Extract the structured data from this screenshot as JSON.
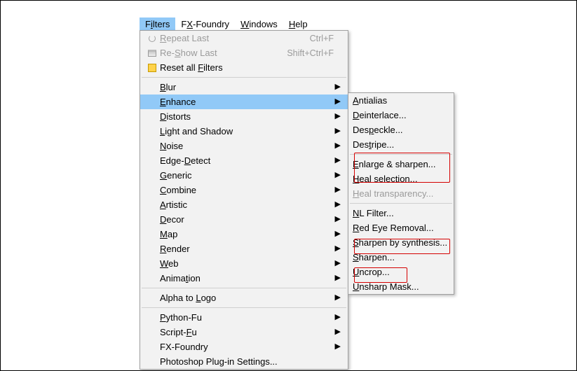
{
  "menubar": [
    {
      "label": "Filters",
      "mnemonic": "i",
      "active": true
    },
    {
      "label": "FX-Foundry",
      "mnemonic": "X"
    },
    {
      "label": "Windows",
      "mnemonic": "W"
    },
    {
      "label": "Help",
      "mnemonic": "H"
    }
  ],
  "primary_menu": [
    {
      "kind": "item",
      "label": "Repeat Last",
      "mnemonic_index": 0,
      "shortcut": "Ctrl+F",
      "icon": "repeat",
      "disabled": true
    },
    {
      "kind": "item",
      "label": "Re-Show Last",
      "mnemonic_index": 3,
      "shortcut": "Shift+Ctrl+F",
      "icon": "reshow",
      "disabled": true
    },
    {
      "kind": "item",
      "label": "Reset all Filters",
      "mnemonic_index": 10,
      "icon": "reset"
    },
    {
      "kind": "sep"
    },
    {
      "kind": "sub",
      "label": "Blur",
      "mnemonic_index": 0
    },
    {
      "kind": "sub",
      "label": "Enhance",
      "mnemonic_index": 0,
      "highlight": true
    },
    {
      "kind": "sub",
      "label": "Distorts",
      "mnemonic_index": 0
    },
    {
      "kind": "sub",
      "label": "Light and Shadow",
      "mnemonic_index": 0
    },
    {
      "kind": "sub",
      "label": "Noise",
      "mnemonic_index": 0
    },
    {
      "kind": "sub",
      "label": "Edge-Detect",
      "mnemonic_index": 5
    },
    {
      "kind": "sub",
      "label": "Generic",
      "mnemonic_index": 0
    },
    {
      "kind": "sub",
      "label": "Combine",
      "mnemonic_index": 0
    },
    {
      "kind": "sub",
      "label": "Artistic",
      "mnemonic_index": 0
    },
    {
      "kind": "sub",
      "label": "Decor",
      "mnemonic_index": 0
    },
    {
      "kind": "sub",
      "label": "Map",
      "mnemonic_index": 0
    },
    {
      "kind": "sub",
      "label": "Render",
      "mnemonic_index": 0
    },
    {
      "kind": "sub",
      "label": "Web",
      "mnemonic_index": 0
    },
    {
      "kind": "sub",
      "label": "Animation",
      "mnemonic_index": 5
    },
    {
      "kind": "sep"
    },
    {
      "kind": "sub",
      "label": "Alpha to Logo",
      "mnemonic_index": 9
    },
    {
      "kind": "sep"
    },
    {
      "kind": "sub",
      "label": "Python-Fu",
      "mnemonic_index": 0
    },
    {
      "kind": "sub",
      "label": "Script-Fu",
      "mnemonic_index": 7
    },
    {
      "kind": "sub",
      "label": "FX-Foundry"
    },
    {
      "kind": "item",
      "label": "Photoshop Plug-in Settings..."
    }
  ],
  "enhance_submenu": [
    {
      "label": "Antialias",
      "mnemonic_index": 0
    },
    {
      "label": "Deinterlace...",
      "mnemonic_index": 0
    },
    {
      "label": "Despeckle...",
      "mnemonic_index": 3
    },
    {
      "label": "Destripe...",
      "mnemonic_index": 3
    },
    {
      "sep": true
    },
    {
      "label": "Enlarge & sharpen...",
      "mnemonic_index": 0
    },
    {
      "label": "Heal selection...",
      "mnemonic_index": 0
    },
    {
      "label": "Heal transparency...",
      "mnemonic_index": 0,
      "disabled": true
    },
    {
      "sep": true
    },
    {
      "label": "NL Filter...",
      "mnemonic_index": 0
    },
    {
      "label": "Red Eye Removal...",
      "mnemonic_index": 0
    },
    {
      "label": "Sharpen by synthesis...",
      "mnemonic_index": 0
    },
    {
      "label": "Sharpen...",
      "mnemonic_index": 0
    },
    {
      "label": "Uncrop...",
      "mnemonic_index": 0
    },
    {
      "label": "Unsharp Mask...",
      "mnemonic_index": 0
    }
  ],
  "triangle": "▶"
}
